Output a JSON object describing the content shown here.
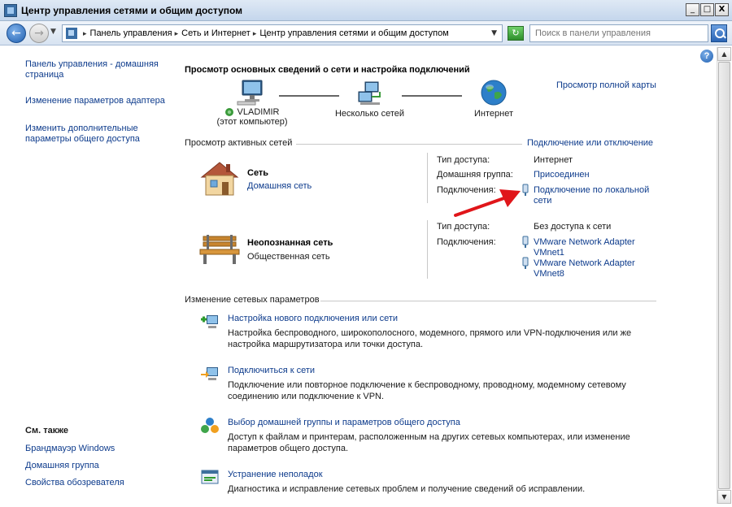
{
  "window": {
    "title": "Центр управления сетями и общим доступом",
    "controls": {
      "minimize": "_",
      "maximize": "□",
      "close": "X"
    }
  },
  "addressbar": {
    "back_symbol": "←",
    "forward_symbol": "→",
    "dropdown_symbol": "▼",
    "breadcrumbs": [
      "Панель управления",
      "Сеть и Интернет",
      "Центр управления сетями и общим доступом"
    ],
    "crumb_separator": "▸",
    "go_symbol": "↻",
    "search_placeholder": "Поиск в панели управления"
  },
  "help": {
    "symbol": "?"
  },
  "scrollbar": {
    "up": "▲",
    "down": "▼"
  },
  "left_pane": {
    "links": [
      "Панель управления - домашняя страница",
      "Изменение параметров адаптера",
      "Изменить дополнительные параметры общего доступа"
    ],
    "see_also_title": "См. также",
    "see_also_links": [
      "Брандмауэр Windows",
      "Домашняя группа",
      "Свойства обозревателя"
    ]
  },
  "main": {
    "heading": "Просмотр основных сведений о сети и настройка подключений",
    "full_map_link": "Просмотр полной карты",
    "map": {
      "computer_name": "VLADIMIR",
      "computer_sub": "(этот компьютер)",
      "middle": "Несколько сетей",
      "internet": "Интернет"
    },
    "active_networks_title": "Просмотр активных сетей",
    "connect_disconnect_link": "Подключение или отключение",
    "networks": [
      {
        "name": "Сеть",
        "type": "Домашняя сеть",
        "type_is_link": true,
        "props": [
          {
            "label": "Тип доступа:",
            "value": "Интернет"
          },
          {
            "label": "Домашняя группа:",
            "value": "Присоединен"
          },
          {
            "label": "Подключения:",
            "value": "Подключение по локальной сети"
          }
        ]
      },
      {
        "name": "Неопознанная сеть",
        "type": "Общественная сеть",
        "type_is_link": false,
        "props": [
          {
            "label": "Тип доступа:",
            "value": "Без доступа к сети"
          },
          {
            "label": "Подключения:",
            "values": [
              "VMware Network Adapter VMnet1",
              "VMware Network Adapter VMnet8"
            ]
          }
        ]
      }
    ],
    "change_settings_title": "Изменение сетевых параметров",
    "tasks": [
      {
        "title": "Настройка нового подключения или сети",
        "desc": "Настройка беспроводного, широкополосного, модемного, прямого или VPN-подключения или же настройка маршрутизатора или точки доступа."
      },
      {
        "title": "Подключиться к сети",
        "desc": "Подключение или повторное подключение к беспроводному, проводному, модемному сетевому соединению или подключение к VPN."
      },
      {
        "title": "Выбор домашней группы и параметров общего доступа",
        "desc": "Доступ к файлам и принтерам, расположенным на других сетевых компьютерах, или изменение параметров общего доступа."
      },
      {
        "title": "Устранение неполадок",
        "desc": "Диагностика и исправление сетевых проблем и получение сведений об исправлении."
      }
    ]
  },
  "colors": {
    "link": "#0d3b8c",
    "annotation_arrow": "#e0161a"
  }
}
